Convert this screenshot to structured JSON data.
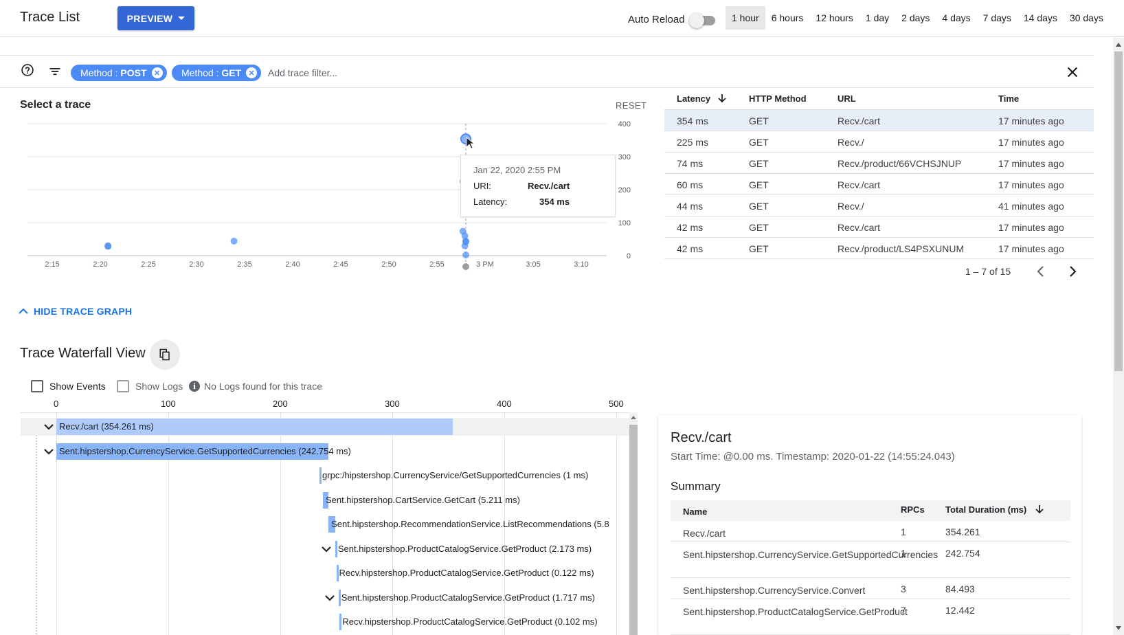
{
  "header": {
    "title": "Trace List",
    "preview_label": "PREVIEW",
    "auto_reload_label": "Auto Reload",
    "ranges": [
      "1 hour",
      "6 hours",
      "12 hours",
      "1 day",
      "2 days",
      "4 days",
      "7 days",
      "14 days",
      "30 days"
    ],
    "active_range": "1 hour"
  },
  "filters": {
    "chips": [
      {
        "key": "Method",
        "value": "POST"
      },
      {
        "key": "Method",
        "value": "GET"
      }
    ],
    "sep": " : ",
    "placeholder": "Add trace filter..."
  },
  "graph": {
    "title": "Select a trace",
    "reset_label": "RESET",
    "hide_label": "HIDE TRACE GRAPH",
    "tooltip": {
      "date": "Jan 22, 2020 2:55 PM",
      "uri_key": "URI:",
      "uri_value": "Recv./cart",
      "latency_key": "Latency:",
      "latency_value": "354 ms"
    }
  },
  "chart_data": {
    "type": "scatter",
    "x_ticks": [
      "2:15",
      "2:20",
      "2:25",
      "2:30",
      "2:35",
      "2:40",
      "2:45",
      "2:50",
      "2:55",
      "3 PM",
      "3:05",
      "3:10"
    ],
    "y_ticks": [
      0,
      100,
      200,
      300,
      400
    ],
    "ylim": [
      0,
      400
    ],
    "x_unit": "minutes after 2:15 PM",
    "points": [
      {
        "x": 5.8,
        "y": 30
      },
      {
        "x": 5.8,
        "y": 28
      },
      {
        "x": 18.9,
        "y": 44
      },
      {
        "x": 43.0,
        "y": 354
      },
      {
        "x": 42.7,
        "y": 225
      },
      {
        "x": 42.7,
        "y": 74
      },
      {
        "x": 42.9,
        "y": 60
      },
      {
        "x": 43.0,
        "y": 44
      },
      {
        "x": 43.0,
        "y": 42
      },
      {
        "x": 42.9,
        "y": 30
      },
      {
        "x": 43.0,
        "y": 2
      }
    ],
    "highlight_index": 3,
    "color": "#4c8bf5",
    "grid": true
  },
  "trace_table": {
    "columns": [
      "Latency",
      "HTTP Method",
      "URL",
      "Time"
    ],
    "rows": [
      {
        "latency": "354 ms",
        "method": "GET",
        "url": "Recv./cart",
        "time": "17 minutes ago"
      },
      {
        "latency": "225 ms",
        "method": "GET",
        "url": "Recv./",
        "time": "17 minutes ago"
      },
      {
        "latency": "74 ms",
        "method": "GET",
        "url": "Recv./product/66VCHSJNUP",
        "time": "17 minutes ago"
      },
      {
        "latency": "60 ms",
        "method": "GET",
        "url": "Recv./cart",
        "time": "17 minutes ago"
      },
      {
        "latency": "44 ms",
        "method": "GET",
        "url": "Recv./",
        "time": "41 minutes ago"
      },
      {
        "latency": "42 ms",
        "method": "GET",
        "url": "Recv./cart",
        "time": "17 minutes ago"
      },
      {
        "latency": "42 ms",
        "method": "GET",
        "url": "Recv./product/LS4PSXUNUM",
        "time": "17 minutes ago"
      }
    ],
    "pagination": "1 – 7 of 15"
  },
  "waterfall": {
    "title": "Trace Waterfall View",
    "show_events_label": "Show Events",
    "show_logs_label": "Show Logs",
    "no_logs_text": "No Logs found for this trace",
    "axis": [
      "0",
      "100",
      "200",
      "300",
      "400",
      "500"
    ],
    "spans": [
      {
        "label": "Recv./cart (354.261 ms)",
        "start": 0,
        "duration": 354.261,
        "expandable": true
      },
      {
        "label": "Sent.hipstershop.CurrencyService.GetSupportedCurrencies (242.754 ms)",
        "start": 0,
        "duration": 242.754,
        "expandable": true
      },
      {
        "label": "grpc:/hipstershop.CurrencyService/GetSupportedCurrencies (1 ms)",
        "start": 235,
        "duration": 1,
        "expandable": false
      },
      {
        "label": "Sent.hipstershop.CartService.GetCart (5.211 ms)",
        "start": 238,
        "duration": 5.211,
        "expandable": false
      },
      {
        "label": "Sent.hipstershop.RecommendationService.ListRecommendations (5.8",
        "start": 243,
        "duration": 5.8,
        "expandable": false
      },
      {
        "label": "Sent.hipstershop.ProductCatalogService.GetProduct (2.173 ms)",
        "start": 249,
        "duration": 2.173,
        "expandable": true
      },
      {
        "label": "Recv.hipstershop.ProductCatalogService.GetProduct (0.122 ms)",
        "start": 250,
        "duration": 0.122,
        "expandable": false
      },
      {
        "label": "Sent.hipstershop.ProductCatalogService.GetProduct (1.717 ms)",
        "start": 252,
        "duration": 1.717,
        "expandable": true
      },
      {
        "label": "Recv.hipstershop.ProductCatalogService.GetProduct (0.102 ms)",
        "start": 253,
        "duration": 0.102,
        "expandable": false
      }
    ]
  },
  "detail": {
    "title": "Recv./cart",
    "subtitle": "Start Time: @0.00 ms. Timestamp: 2020-01-22 (14:55:24.043)",
    "summary_title": "Summary",
    "columns": [
      "Name",
      "RPCs",
      "Total Duration (ms)"
    ],
    "rows": [
      {
        "name": "Recv./cart",
        "rpcs": "1",
        "duration": "354.261"
      },
      {
        "name": "Sent.hipstershop.CurrencyService.GetSupportedCurrencies",
        "rpcs": "1",
        "duration": "242.754"
      },
      {
        "name": "Sent.hipstershop.CurrencyService.Convert",
        "rpcs": "3",
        "duration": "84.493"
      },
      {
        "name": "Sent.hipstershop.ProductCatalogService.GetProduct",
        "rpcs": "7",
        "duration": "12.442"
      }
    ]
  }
}
